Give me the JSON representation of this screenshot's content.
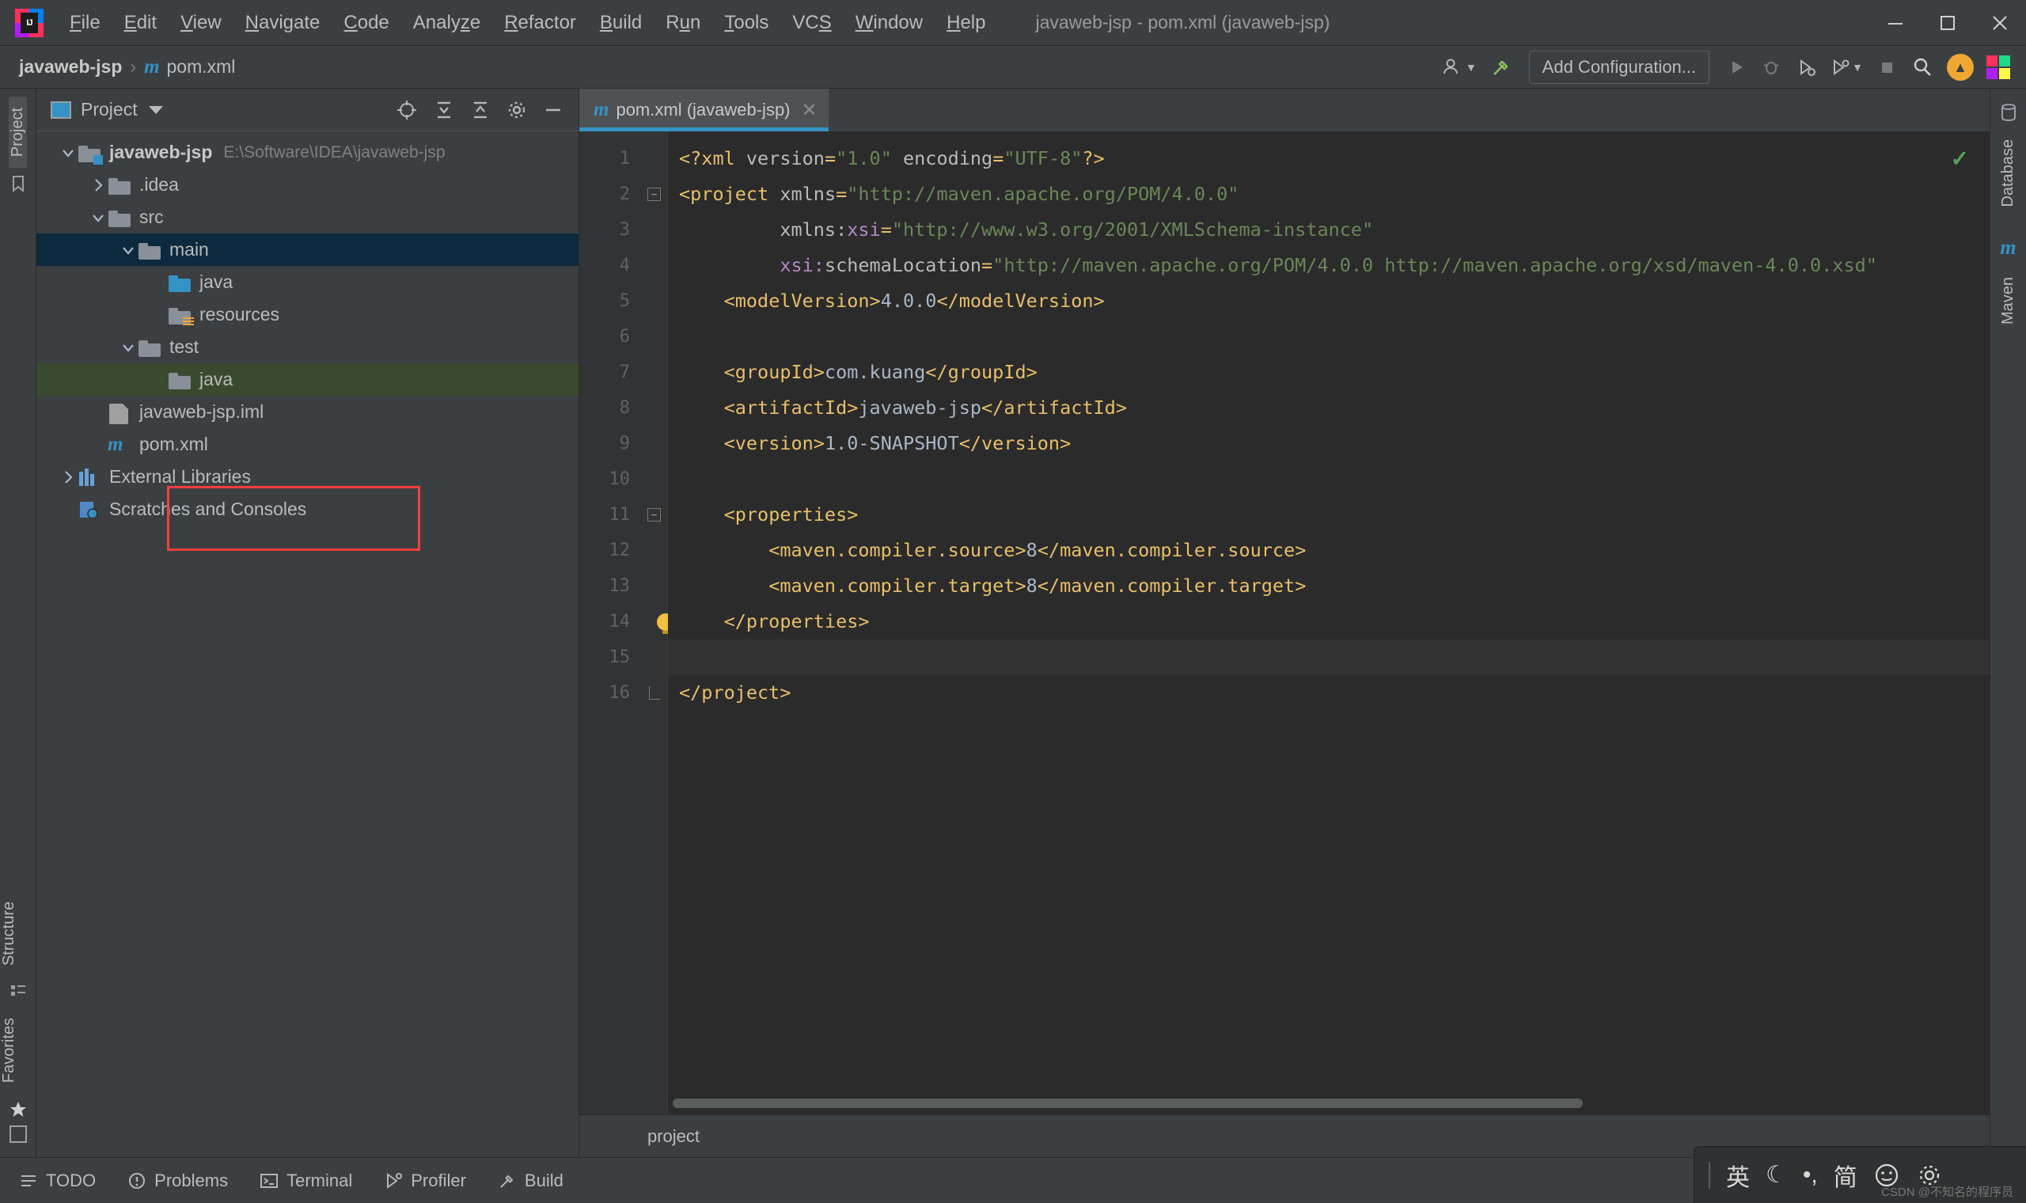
{
  "window": {
    "title": "javaweb-jsp - pom.xml (javaweb-jsp)",
    "logo_text": "IJ",
    "minimize": "─",
    "maximize": "❐",
    "close": "✕"
  },
  "menubar": {
    "items": [
      {
        "label": "File",
        "mnemonic": "F"
      },
      {
        "label": "Edit",
        "mnemonic": "E"
      },
      {
        "label": "View",
        "mnemonic": "V"
      },
      {
        "label": "Navigate",
        "mnemonic": "N"
      },
      {
        "label": "Code",
        "mnemonic": "C"
      },
      {
        "label": "Analyze",
        "mnemonic": "z"
      },
      {
        "label": "Refactor",
        "mnemonic": "R"
      },
      {
        "label": "Build",
        "mnemonic": "B"
      },
      {
        "label": "Run",
        "mnemonic": "u"
      },
      {
        "label": "Tools",
        "mnemonic": "T"
      },
      {
        "label": "VCS",
        "mnemonic": "S"
      },
      {
        "label": "Window",
        "mnemonic": "W"
      },
      {
        "label": "Help",
        "mnemonic": "H"
      }
    ]
  },
  "navbar": {
    "breadcrumb": [
      {
        "label": "javaweb-jsp",
        "icon": "none"
      },
      {
        "label": "pom.xml",
        "icon": "maven-m-icon"
      }
    ],
    "separator": "›",
    "add_configuration_label": "Add Configuration...",
    "icons": [
      "user-avatar-icon",
      "hammer-build-icon",
      "run-icon",
      "debug-icon",
      "run-coverage-icon",
      "profiler-icon",
      "stop-icon",
      "search-icon",
      "update-icon",
      "ide-logo-icon"
    ]
  },
  "left_stripe": {
    "top_label": "Project",
    "bottom_labels": [
      "Structure",
      "Favorites"
    ]
  },
  "right_stripe": {
    "labels": [
      "Database",
      "Maven"
    ]
  },
  "project_panel": {
    "title": "Project",
    "header_icons": [
      "locate-icon",
      "expand-all-icon",
      "collapse-all-icon",
      "settings-gear-icon",
      "hide-icon"
    ],
    "tree": [
      {
        "label": "javaweb-jsp",
        "path": "E:\\Software\\IDEA\\javaweb-jsp",
        "depth": 0,
        "arrow": "down",
        "icon": "module-folder-icon",
        "bold": true,
        "state": "normal"
      },
      {
        "label": ".idea",
        "path": "",
        "depth": 1,
        "arrow": "right",
        "icon": "folder-icon",
        "bold": false,
        "state": "normal"
      },
      {
        "label": "src",
        "path": "",
        "depth": 1,
        "arrow": "down",
        "icon": "folder-icon",
        "bold": false,
        "state": "normal"
      },
      {
        "label": "main",
        "path": "",
        "depth": 2,
        "arrow": "down",
        "icon": "folder-icon",
        "bold": false,
        "state": "selected"
      },
      {
        "label": "java",
        "path": "",
        "depth": 3,
        "arrow": "none",
        "icon": "source-root-folder-icon",
        "bold": false,
        "state": "normal"
      },
      {
        "label": "resources",
        "path": "",
        "depth": 3,
        "arrow": "none",
        "icon": "resources-root-folder-icon",
        "bold": false,
        "state": "normal"
      },
      {
        "label": "test",
        "path": "",
        "depth": 2,
        "arrow": "down",
        "icon": "folder-icon",
        "bold": false,
        "state": "normal"
      },
      {
        "label": "java",
        "path": "",
        "depth": 3,
        "arrow": "none",
        "icon": "folder-icon",
        "bold": false,
        "state": "highlighted"
      },
      {
        "label": "javaweb-jsp.iml",
        "path": "",
        "depth": 1,
        "arrow": "none",
        "icon": "iml-file-icon",
        "bold": false,
        "state": "normal"
      },
      {
        "label": "pom.xml",
        "path": "",
        "depth": 1,
        "arrow": "none",
        "icon": "maven-m-icon",
        "bold": false,
        "state": "normal"
      },
      {
        "label": "External Libraries",
        "path": "",
        "depth": 0,
        "arrow": "right",
        "icon": "libraries-icon",
        "bold": false,
        "state": "normal"
      },
      {
        "label": "Scratches and Consoles",
        "path": "",
        "depth": 0,
        "arrow": "none",
        "icon": "scratches-icon",
        "bold": false,
        "state": "normal"
      }
    ]
  },
  "editor": {
    "tab": {
      "label": "pom.xml (javaweb-jsp)",
      "icon": "maven-m-icon",
      "close": "✕"
    },
    "inspection_status": "✓",
    "breadcrumb": "project",
    "lines": [
      {
        "n": 1,
        "fold": "none",
        "html": "<span class='tk-punct'>&lt;?xml</span> <span class='tk-attr'>version</span><span class='tk-punct'>=</span><span class='tk-str'>\"1.0\"</span> <span class='tk-attr'>encoding</span><span class='tk-punct'>=</span><span class='tk-str'>\"UTF-8\"</span><span class='tk-punct'>?&gt;</span>"
      },
      {
        "n": 2,
        "fold": "minus",
        "html": "<span class='tk-punct'>&lt;</span><span class='tk-tag'>project</span> <span class='tk-attr'>xmlns</span><span class='tk-punct'>=</span><span class='tk-str'>\"http://maven.apache.org/POM/4.0.0\"</span>"
      },
      {
        "n": 3,
        "fold": "none",
        "html": "         <span class='tk-attr'>xmlns:</span><span class='tk-ns'>xsi</span><span class='tk-punct'>=</span><span class='tk-str'>\"http://www.w3.org/2001/XMLSchema-instance\"</span>"
      },
      {
        "n": 4,
        "fold": "none",
        "html": "         <span class='tk-ns'>xsi:</span><span class='tk-attr'>schemaLocation</span><span class='tk-punct'>=</span><span class='tk-str'>\"http://maven.apache.org/POM/4.0.0 http://maven.apache.org/xsd/maven-4.0.0.xsd\"</span>"
      },
      {
        "n": 5,
        "fold": "none",
        "html": "    <span class='tk-punct'>&lt;</span><span class='tk-tag'>modelVersion</span><span class='tk-punct'>&gt;</span><span class='tk-txt'>4.0.0</span><span class='tk-punct'>&lt;/</span><span class='tk-tag'>modelVersion</span><span class='tk-punct'>&gt;</span>"
      },
      {
        "n": 6,
        "fold": "none",
        "html": ""
      },
      {
        "n": 7,
        "fold": "none",
        "html": "    <span class='tk-punct'>&lt;</span><span class='tk-tag'>groupId</span><span class='tk-punct'>&gt;</span><span class='tk-txt'>com.kuang</span><span class='tk-punct'>&lt;/</span><span class='tk-tag'>groupId</span><span class='tk-punct'>&gt;</span>"
      },
      {
        "n": 8,
        "fold": "none",
        "html": "    <span class='tk-punct'>&lt;</span><span class='tk-tag'>artifactId</span><span class='tk-punct'>&gt;</span><span class='tk-txt'>javaweb-jsp</span><span class='tk-punct'>&lt;/</span><span class='tk-tag'>artifactId</span><span class='tk-punct'>&gt;</span>"
      },
      {
        "n": 9,
        "fold": "none",
        "html": "    <span class='tk-punct'>&lt;</span><span class='tk-tag'>version</span><span class='tk-punct'>&gt;</span><span class='tk-txt'>1.0-SNAPSHOT</span><span class='tk-punct'>&lt;/</span><span class='tk-tag'>version</span><span class='tk-punct'>&gt;</span>"
      },
      {
        "n": 10,
        "fold": "none",
        "html": ""
      },
      {
        "n": 11,
        "fold": "minus",
        "html": "    <span class='tk-punct'>&lt;</span><span class='tk-tag'>properties</span><span class='tk-punct'>&gt;</span>"
      },
      {
        "n": 12,
        "fold": "none",
        "html": "        <span class='tk-punct'>&lt;</span><span class='tk-tag'>maven.compiler.source</span><span class='tk-punct'>&gt;</span><span class='tk-txt'>8</span><span class='tk-punct'>&lt;/</span><span class='tk-tag'>maven.compiler.source</span><span class='tk-punct'>&gt;</span>"
      },
      {
        "n": 13,
        "fold": "none",
        "html": "        <span class='tk-punct'>&lt;</span><span class='tk-tag'>maven.compiler.target</span><span class='tk-punct'>&gt;</span><span class='tk-txt'>8</span><span class='tk-punct'>&lt;/</span><span class='tk-tag'>maven.compiler.target</span><span class='tk-punct'>&gt;</span>"
      },
      {
        "n": 14,
        "fold": "end",
        "bulb": true,
        "html": "    <span class='tk-punct'>&lt;/</span><span class='tk-tag'>properties</span><span class='tk-punct'>&gt;</span>"
      },
      {
        "n": 15,
        "fold": "none",
        "hl": true,
        "html": ""
      },
      {
        "n": 16,
        "fold": "end",
        "html": "<span class='tk-punct'>&lt;/</span><span class='tk-tag'>project</span><span class='tk-punct'>&gt;</span>"
      }
    ]
  },
  "bottombar": {
    "items": [
      {
        "label": "TODO",
        "icon": "todo-list-icon"
      },
      {
        "label": "Problems",
        "icon": "problems-warning-icon"
      },
      {
        "label": "Terminal",
        "icon": "terminal-icon"
      },
      {
        "label": "Profiler",
        "icon": "profiler-icon"
      },
      {
        "label": "Build",
        "icon": "build-hammer-icon"
      }
    ]
  },
  "ime_tray": {
    "items": [
      "英",
      "☾",
      "•,",
      "简"
    ],
    "icons": [
      "ime-language-icon",
      "ime-moon-icon",
      "ime-punctuation-icon",
      "ime-simplified-icon",
      "ime-emoji-icon",
      "ime-settings-icon"
    ]
  },
  "watermark": "CSDN @不知名的程序员",
  "colors": {
    "accent": "#3592c4",
    "selection": "#0d293e",
    "highlight_green": "#3a4a2e",
    "red_box": "#f43f3f",
    "panel_bg": "#3c3f41",
    "editor_bg": "#2b2b2b",
    "gutter_bg": "#313335"
  }
}
